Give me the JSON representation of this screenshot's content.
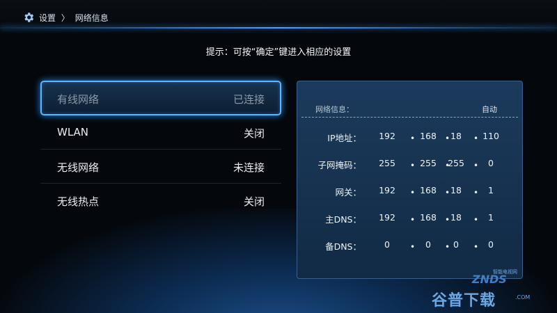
{
  "header": {
    "gear_icon": "gear-icon",
    "breadcrumb": [
      "设置",
      "〉",
      "网络信息"
    ]
  },
  "hint": "提示：可按“确定”键进入相应的设置",
  "menu": [
    {
      "label": "有线网络",
      "value": "已连接",
      "selected": true
    },
    {
      "label": "WLAN",
      "value": "关闭",
      "selected": false
    },
    {
      "label": "无线网络",
      "value": "未连接",
      "selected": false
    },
    {
      "label": "无线热点",
      "value": "关闭",
      "selected": false
    }
  ],
  "panel": {
    "title": "网络信息：",
    "mode": "自动",
    "rows": [
      {
        "label": "IP地址：",
        "octets": [
          "192",
          "168",
          "18",
          "110"
        ]
      },
      {
        "label": "子网掩码：",
        "octets": [
          "255",
          "255",
          "255",
          "0"
        ]
      },
      {
        "label": "网关：",
        "octets": [
          "192",
          "168",
          "18",
          "1"
        ]
      },
      {
        "label": "主DNS：",
        "octets": [
          "192",
          "168",
          "18",
          "1"
        ]
      },
      {
        "label": "备DNS：",
        "octets": [
          "0",
          "0",
          "0",
          "0"
        ]
      }
    ]
  },
  "watermark": {
    "cn": "谷普下载",
    "brand": "ZNDS",
    "sub": "智能电视网",
    "com": ".COM"
  },
  "colors": {
    "accent": "#5fb6ff",
    "panel_bg": "#1a3757",
    "background": "#04070b"
  }
}
